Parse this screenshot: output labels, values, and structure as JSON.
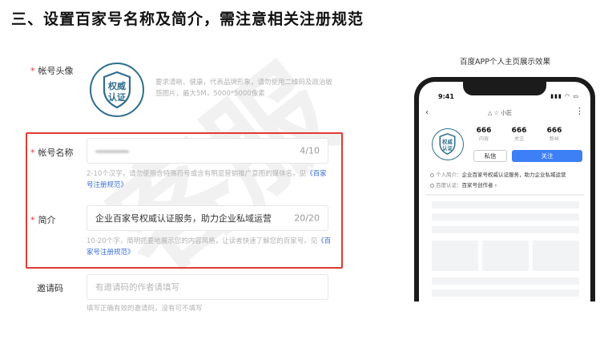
{
  "page": {
    "title": "三、设置百家号名称及简介，需注意相关注册规范",
    "watermark": "客服"
  },
  "form": {
    "avatar": {
      "label": "帐号头像",
      "badge_line1": "权威",
      "badge_line2": "认证",
      "hint": "要求清晰、健康，代表品牌形象，请勿使用二维码及政治敏感图片，最大5M，5000*5000像素"
    },
    "name": {
      "label": "帐号名称",
      "count": "4/10",
      "hint": "2-10个汉字，请勿使用含特殊符号或含有明显营销推广意图的媒体名。见",
      "link": "《百家号注册规范》"
    },
    "intro": {
      "label": "简介",
      "value": "企业百家号权威认证服务，助力企业私域运营",
      "count": "20/20",
      "hint": "10-20个字，简明扼要地展示您的内容风格，让读者快速了解您的百家号。见",
      "link": "《百家号注册规范》"
    },
    "invite": {
      "label": "邀请码",
      "placeholder": "有邀请码的作者请填写",
      "hint": "填写正确有效的邀请码，没有可不填写"
    }
  },
  "preview": {
    "caption": "百度APP个人主页展示效果",
    "time": "9:41",
    "status_icons": "▮▮▮ ◠ ▭",
    "nav_title": "△ ☆ 小匠",
    "more": "⋮",
    "avatar_line1": "权威",
    "avatar_line2": "认证",
    "stats": [
      {
        "num": "666",
        "label": "内容"
      },
      {
        "num": "666",
        "label": "关注"
      },
      {
        "num": "666",
        "label": "粉丝"
      }
    ],
    "msg_button": "私信",
    "follow_button": "关注",
    "intro_key": "个人简介：",
    "intro_value": "企业百家号权威认证服务，助力企业私域运营",
    "cert_key": "百度认证：",
    "cert_value": "百家号创作者 ›"
  },
  "colors": {
    "highlight_border": "#e03b32",
    "link": "#3b6fd6",
    "follow_button": "#3d7ff5",
    "badge": "#2f6e8c"
  }
}
